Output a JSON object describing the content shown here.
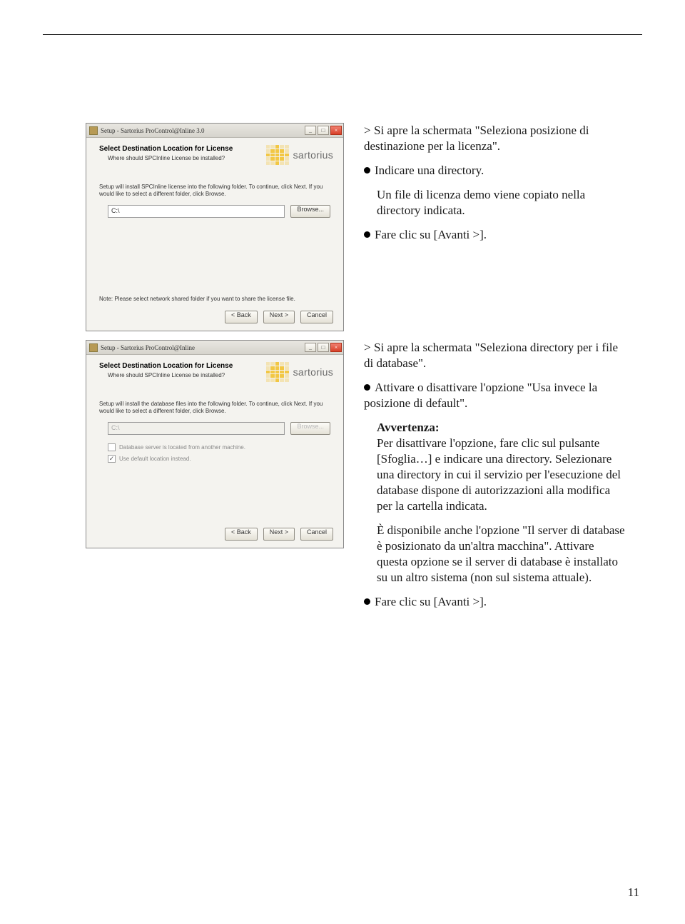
{
  "page_number": "11",
  "screenshot1": {
    "title": "Setup - Sartorius ProControl@Inline 3.0",
    "heading": "Select Destination Location for License",
    "subq": "Where should SPCInline License be installed?",
    "instr": "Setup will install SPCInline license into the following folder. To continue, click Next. If you would like to select a different folder, click Browse.",
    "path": "C:\\",
    "browse": "Browse...",
    "note": "Note: Please select network shared folder if you want to share the license file.",
    "back": "< Back",
    "next": "Next >",
    "cancel": "Cancel",
    "logo": "sartorius"
  },
  "screenshot2": {
    "title": "Setup - Sartorius ProControl@Inline",
    "heading": "Select Destination Location for License",
    "subq": "Where should SPCInline License be installed?",
    "instr": "Setup will install the database files into the following folder. To continue, click Next. If you would like to select a different folder, click Browse.",
    "path": "C:\\",
    "browse": "Browse...",
    "chk1": "Database server is located from another machine.",
    "chk2": "Use default location instead.",
    "back": "< Back",
    "next": "Next >",
    "cancel": "Cancel",
    "logo": "sartorius"
  },
  "text1": {
    "line1": "Si apre la schermata \"Seleziona posizione di destinazione per la licenza\".",
    "line2": "Indicare una directory.",
    "line3": "Un file di licenza demo viene copiato nella directory indicata.",
    "line4": "Fare clic su [Avanti >]."
  },
  "text2": {
    "line1": "Si apre la schermata \"Seleziona directory per i file di database\".",
    "line2": "Attivare o disattivare l'opzione \"Usa invece la posizione di default\".",
    "warn_title": "Avvertenza:",
    "warn_body": "Per disattivare l'opzione, fare clic sul pulsante [Sfoglia…] e indicare una directory. Selezionare una directory in cui il servizio per l'esecuzione del database dispone di autorizzazioni alla modifica per la cartella indicata.",
    "line3": "È disponibile anche l'opzione \"Il server di database è posizionato da un'altra macchina\". Attivare questa opzione se il server di database è installato su un altro sistema (non sul sistema attuale).",
    "line4": "Fare clic su [Avanti >]."
  }
}
